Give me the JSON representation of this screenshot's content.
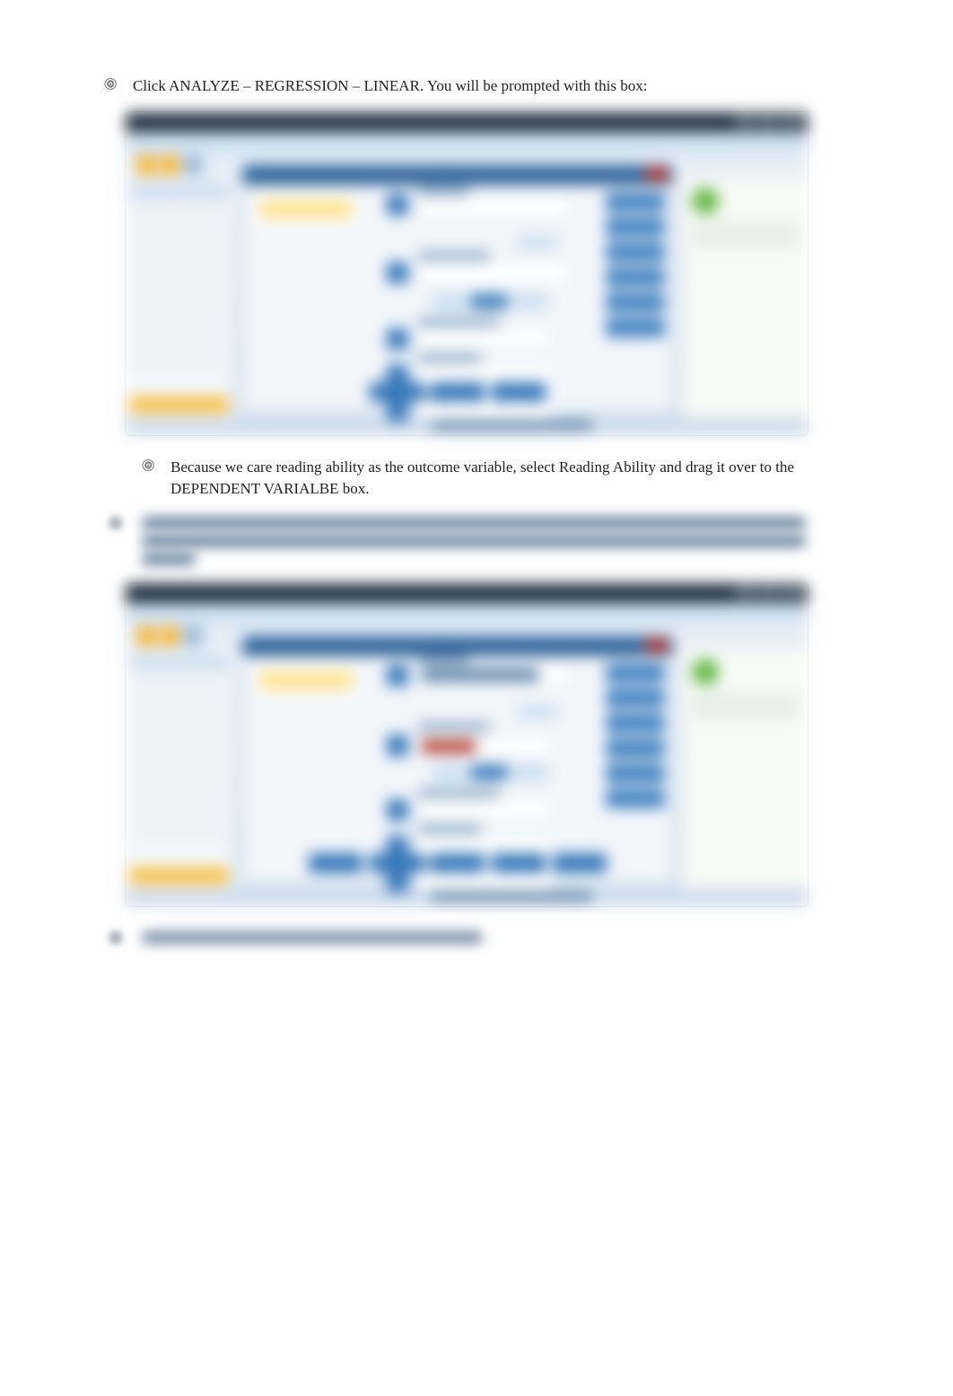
{
  "bullets": {
    "b1": "Click ANALYZE  – REGRESSION – LINEAR. You will be prompted with this box:",
    "b2": "Because we care reading ability as the outcome variable, select Reading Ability and drag it over to the DEPENDENT VARIALBE box."
  },
  "glyph": "🞋"
}
